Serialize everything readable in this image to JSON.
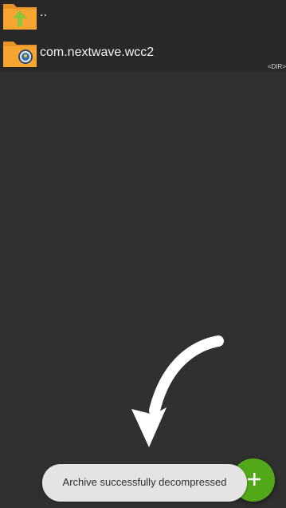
{
  "file_list": {
    "items": [
      {
        "name": "..",
        "type": "parent-folder",
        "icon": "folder-up-icon"
      },
      {
        "name": "com.nextwave.wcc2",
        "type": "directory",
        "icon": "folder-app-icon",
        "tag": "<DIR>"
      }
    ]
  },
  "annotation": {
    "icon": "curved-arrow-icon"
  },
  "fab": {
    "icon": "plus-icon",
    "color": "#52a819"
  },
  "toast": {
    "message": "Archive successfully decompressed"
  },
  "colors": {
    "background": "#303030",
    "list_background": "#282828",
    "folder": "#f7a531",
    "accent": "#52a819"
  }
}
